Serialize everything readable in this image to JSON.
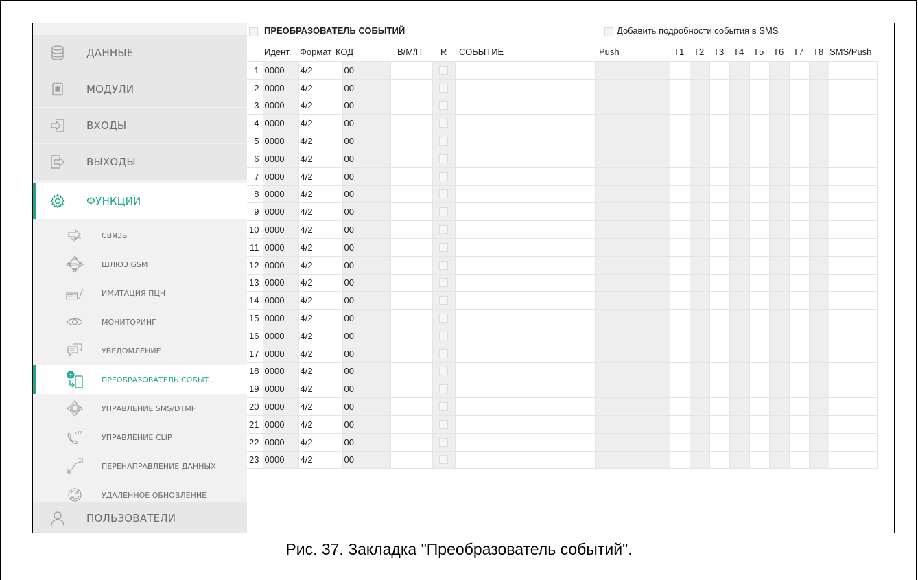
{
  "sidebar": {
    "main_items": [
      {
        "label": "ДАННЫЕ",
        "icon": "database-icon"
      },
      {
        "label": "МОДУЛИ",
        "icon": "module-icon"
      },
      {
        "label": "ВХОДЫ",
        "icon": "input-icon"
      },
      {
        "label": "ВЫХОДЫ",
        "icon": "output-icon"
      },
      {
        "label": "ФУНКЦИИ",
        "icon": "gear-icon",
        "active": true
      },
      {
        "label": "ПОЛЬЗОВАТЕЛИ",
        "icon": "user-icon"
      }
    ],
    "sub_items": [
      {
        "label": "СВЯЗЬ",
        "icon": "communication-icon"
      },
      {
        "label": "ШЛЮЗ GSM",
        "icon": "gsm-gateway-icon"
      },
      {
        "label": "ИМИТАЦИЯ ПЦН",
        "icon": "pstn-simulation-icon"
      },
      {
        "label": "МОНИТОРИНГ",
        "icon": "eye-icon"
      },
      {
        "label": "УВЕДОМЛЕНИЕ",
        "icon": "notification-icon"
      },
      {
        "label": "ПРЕОБРАЗОВАТЕЛЬ СОБЫТ...",
        "icon": "event-converter-icon",
        "active": true
      },
      {
        "label": "УПРАВЛЕНИЕ SMS/DTMF",
        "icon": "sms-dtmf-icon"
      },
      {
        "label": "УПРАВЛЕНИЕ CLIP",
        "icon": "clip-icon"
      },
      {
        "label": "ПЕРЕНАПРАВЛЕНИЕ ДАННЫХ",
        "icon": "data-redirect-icon"
      },
      {
        "label": "УДАЛЕННОЕ ОБНОВЛЕНИЕ",
        "icon": "remote-update-icon"
      }
    ]
  },
  "panel": {
    "title": "ПРЕОБРАЗОВАТЕЛЬ СОБЫТИЙ",
    "sms_details_label": "Добавить подробности события в SMS"
  },
  "columns": [
    "Идент.",
    "Формат",
    "КОД",
    "В/М/П",
    "R",
    "СОБЫТИЕ",
    "Push",
    "T1",
    "T2",
    "T3",
    "T4",
    "T5",
    "T6",
    "T7",
    "T8",
    "SMS/Push"
  ],
  "rows": [
    {
      "n": "1",
      "id": "0000",
      "format": "4/2",
      "code": "00"
    },
    {
      "n": "2",
      "id": "0000",
      "format": "4/2",
      "code": "00"
    },
    {
      "n": "3",
      "id": "0000",
      "format": "4/2",
      "code": "00"
    },
    {
      "n": "4",
      "id": "0000",
      "format": "4/2",
      "code": "00"
    },
    {
      "n": "5",
      "id": "0000",
      "format": "4/2",
      "code": "00"
    },
    {
      "n": "6",
      "id": "0000",
      "format": "4/2",
      "code": "00"
    },
    {
      "n": "7",
      "id": "0000",
      "format": "4/2",
      "code": "00"
    },
    {
      "n": "8",
      "id": "0000",
      "format": "4/2",
      "code": "00"
    },
    {
      "n": "9",
      "id": "0000",
      "format": "4/2",
      "code": "00"
    },
    {
      "n": "10",
      "id": "0000",
      "format": "4/2",
      "code": "00"
    },
    {
      "n": "11",
      "id": "0000",
      "format": "4/2",
      "code": "00"
    },
    {
      "n": "12",
      "id": "0000",
      "format": "4/2",
      "code": "00"
    },
    {
      "n": "13",
      "id": "0000",
      "format": "4/2",
      "code": "00"
    },
    {
      "n": "14",
      "id": "0000",
      "format": "4/2",
      "code": "00"
    },
    {
      "n": "15",
      "id": "0000",
      "format": "4/2",
      "code": "00"
    },
    {
      "n": "16",
      "id": "0000",
      "format": "4/2",
      "code": "00"
    },
    {
      "n": "17",
      "id": "0000",
      "format": "4/2",
      "code": "00"
    },
    {
      "n": "18",
      "id": "0000",
      "format": "4/2",
      "code": "00"
    },
    {
      "n": "19",
      "id": "0000",
      "format": "4/2",
      "code": "00"
    },
    {
      "n": "20",
      "id": "0000",
      "format": "4/2",
      "code": "00"
    },
    {
      "n": "21",
      "id": "0000",
      "format": "4/2",
      "code": "00"
    },
    {
      "n": "22",
      "id": "0000",
      "format": "4/2",
      "code": "00"
    },
    {
      "n": "23",
      "id": "0000",
      "format": "4/2",
      "code": "00"
    }
  ],
  "caption": "Рис. 37. Закладка \"Преобразователь событий\".",
  "colors": {
    "accent": "#1fa88c",
    "sidebar_bg": "#f1f1f1",
    "main_item_bg": "#e7e7e7",
    "cell_gray": "#eeeeee"
  }
}
